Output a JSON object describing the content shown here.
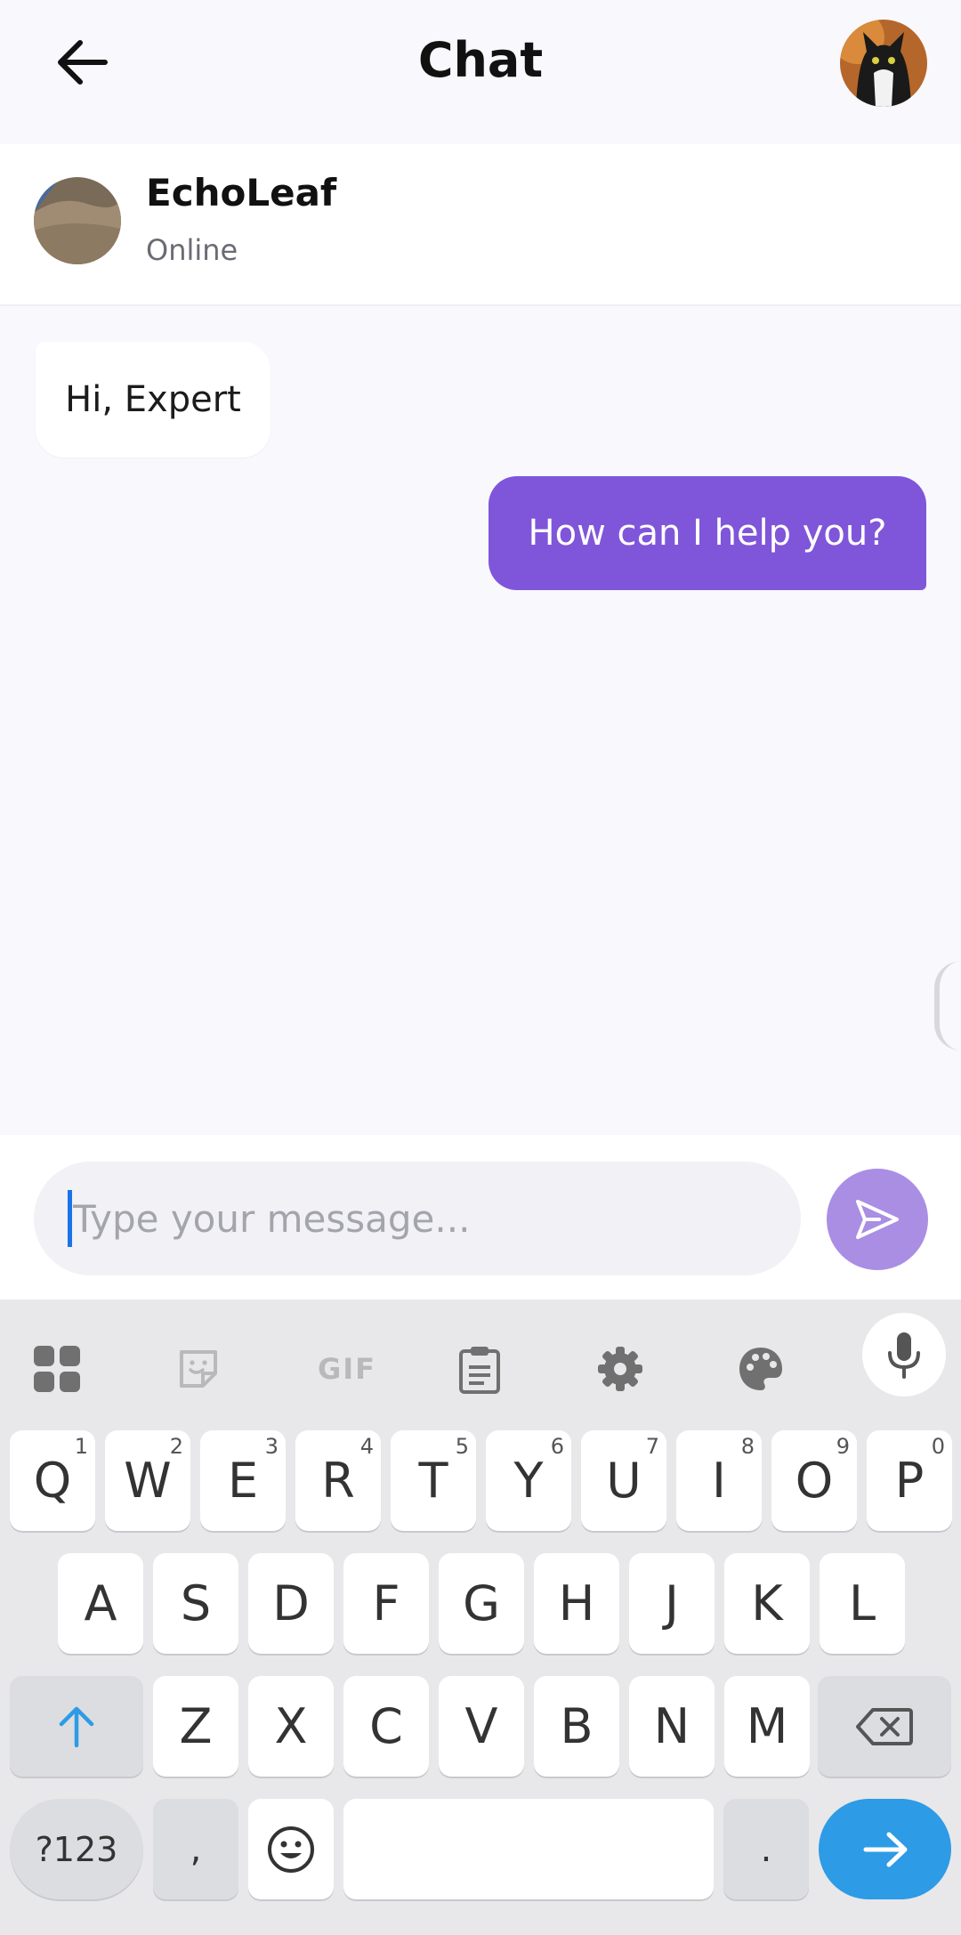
{
  "header": {
    "title": "Chat"
  },
  "contact": {
    "name": "EchoLeaf",
    "status": "Online"
  },
  "messages": [
    {
      "direction": "incoming",
      "text": "Hi, Expert"
    },
    {
      "direction": "outgoing",
      "text": "How can I help you?"
    }
  ],
  "composer": {
    "placeholder": "Type your message...",
    "value": ""
  },
  "keyboard": {
    "toolbar": [
      "apps-grid-icon",
      "sticker-icon",
      "GIF",
      "clipboard-icon",
      "settings-gear-icon",
      "theme-palette-icon",
      "microphone-icon"
    ],
    "row1": [
      {
        "key": "Q",
        "hint": "1"
      },
      {
        "key": "W",
        "hint": "2"
      },
      {
        "key": "E",
        "hint": "3"
      },
      {
        "key": "R",
        "hint": "4"
      },
      {
        "key": "T",
        "hint": "5"
      },
      {
        "key": "Y",
        "hint": "6"
      },
      {
        "key": "U",
        "hint": "7"
      },
      {
        "key": "I",
        "hint": "8"
      },
      {
        "key": "O",
        "hint": "9"
      },
      {
        "key": "P",
        "hint": "0"
      }
    ],
    "row2": [
      "A",
      "S",
      "D",
      "F",
      "G",
      "H",
      "J",
      "K",
      "L"
    ],
    "row3": [
      "Z",
      "X",
      "C",
      "V",
      "B",
      "N",
      "M"
    ],
    "symbols_label": "?123",
    "comma": ",",
    "period": "."
  },
  "colors": {
    "accent": "#7f56d9",
    "send_button": "#a98ee4",
    "enter_key": "#2d9be6",
    "background": "#f8f8fd"
  }
}
